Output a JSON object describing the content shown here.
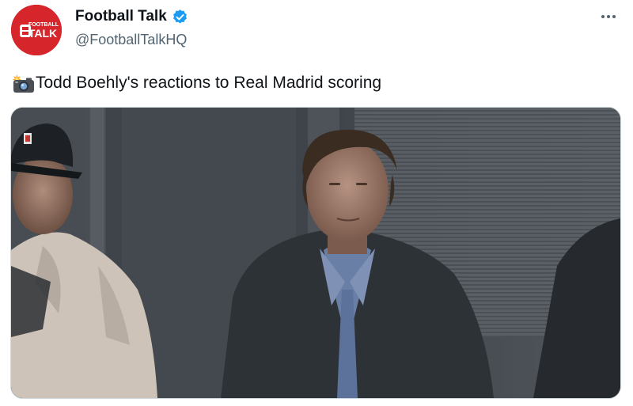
{
  "account": {
    "display_name": "Football Talk",
    "handle": "@FootballTalkHQ",
    "avatar_logo_top": "FOOTBALL",
    "avatar_logo_bottom": "TALK",
    "verified": true
  },
  "tweet": {
    "emoji_icon": "camera-with-flash-icon",
    "text": "Todd Boehly's reactions to Real Madrid scoring"
  },
  "media": {
    "type": "image",
    "icon": "photo"
  },
  "colors": {
    "brand_red": "#d6262b",
    "verified_blue": "#1d9bf0",
    "text_primary": "#0f1419",
    "text_secondary": "#536471"
  }
}
